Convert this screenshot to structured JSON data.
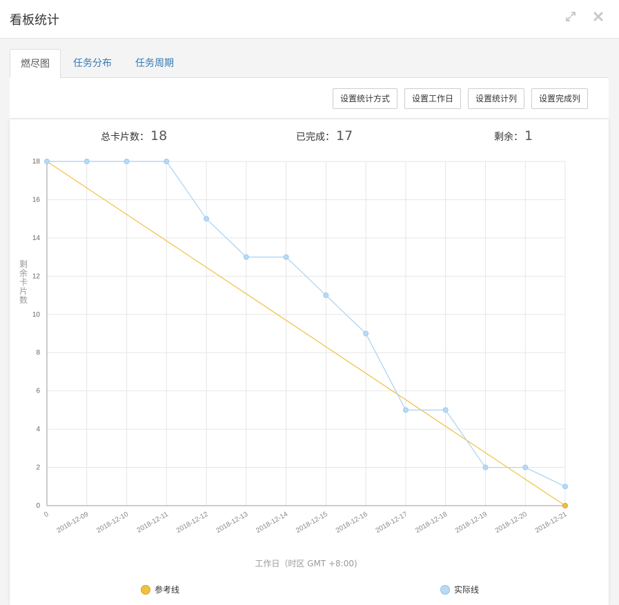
{
  "modal": {
    "title": "看板统计",
    "expand_icon": "expand-icon",
    "close_icon": "close-icon"
  },
  "tabs": [
    {
      "label": "燃尽图",
      "active": true
    },
    {
      "label": "任务分布",
      "active": false
    },
    {
      "label": "任务周期",
      "active": false
    }
  ],
  "toolbar": {
    "buttons": [
      "设置统计方式",
      "设置工作日",
      "设置统计列",
      "设置完成列"
    ]
  },
  "stats": {
    "total_label": "总卡片数：",
    "total_value": "18",
    "done_label": "已完成：",
    "done_value": "17",
    "remain_label": "剩余：",
    "remain_value": "1"
  },
  "legend": {
    "reference": "参考线",
    "actual": "实际线"
  },
  "colors": {
    "reference": "#f0c040",
    "actual": "#a8d1f0",
    "link": "#337ab7"
  },
  "chart_data": {
    "type": "line",
    "x": [
      "0",
      "2018-12-09",
      "2018-12-10",
      "2018-12-11",
      "2018-12-12",
      "2018-12-13",
      "2018-12-14",
      "2018-12-15",
      "2018-12-16",
      "2018-12-17",
      "2018-12-18",
      "2018-12-19",
      "2018-12-20",
      "2018-12-21"
    ],
    "series": [
      {
        "name": "参考线",
        "values": [
          18,
          null,
          null,
          null,
          null,
          null,
          null,
          null,
          null,
          null,
          null,
          null,
          null,
          0
        ],
        "shape": "straight"
      },
      {
        "name": "实际线",
        "values": [
          18,
          18,
          18,
          18,
          15,
          13,
          13,
          11,
          9,
          5,
          5,
          2,
          2,
          1
        ]
      }
    ],
    "xlabel": "工作日（时区 GMT +8:00)",
    "ylabel": "剩余卡片数",
    "ylim": [
      0,
      18
    ],
    "yticks": [
      0,
      2,
      4,
      6,
      8,
      10,
      12,
      14,
      16,
      18
    ],
    "grid": true,
    "legend": "bottom"
  }
}
